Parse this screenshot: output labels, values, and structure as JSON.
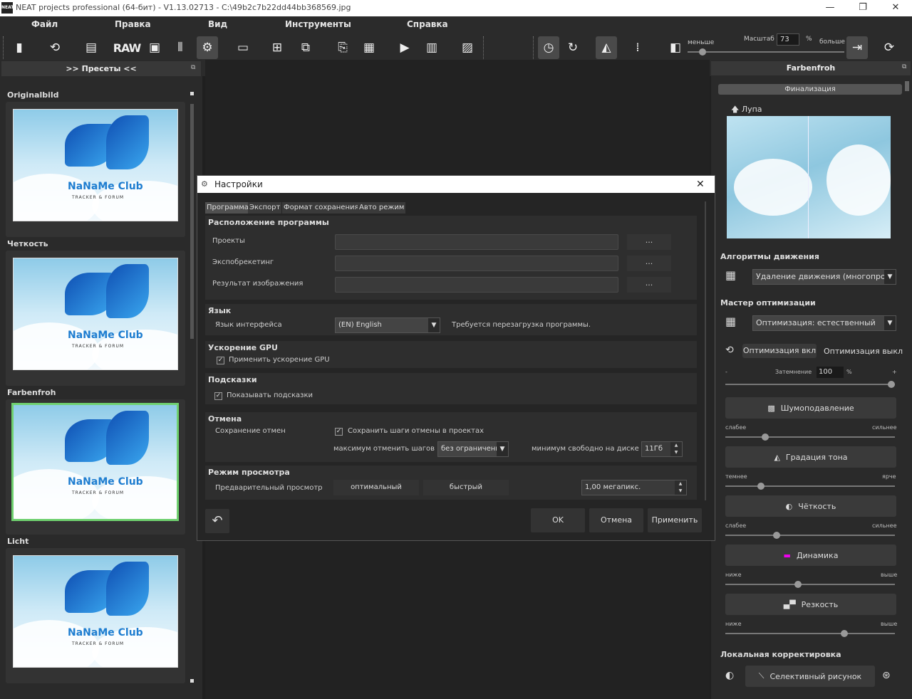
{
  "window": {
    "title": "NEAT projects professional (64-бит) - V1.13.02713 - C:\\49b2c7b22dd44bb368569.jpg",
    "logo_text": "NEAT",
    "minimize": "—",
    "restore": "❐",
    "close": "✕"
  },
  "menu": {
    "file": "Файл",
    "edit": "Правка",
    "view": "Вид",
    "tools": "Инструменты",
    "help": "Справка"
  },
  "toolbar": {
    "raw_label": "RAW",
    "zoom_less": "меньше",
    "zoom_more": "больше",
    "zoom_label": "Масштаб",
    "zoom_value": "73",
    "zoom_unit": "%"
  },
  "left_panel": {
    "title": ">> Пресеты <<",
    "presets": [
      {
        "label": "Originalbild",
        "selected": false
      },
      {
        "label": "Четкость",
        "selected": false
      },
      {
        "label": "Farbenfroh",
        "selected": true
      },
      {
        "label": "Licht",
        "selected": false
      }
    ],
    "thumb_brand": "NaNaMe Club",
    "thumb_sub": "TRACKER & FORUM"
  },
  "right_panel": {
    "title": "Farbenfroh",
    "finalize_button": "Финализация",
    "loupe_label": "Лупа",
    "motion_section": "Алгоритмы движения",
    "motion_value": "Удаление движения (многопроходн",
    "optim_section": "Мастер оптимизации",
    "optim_value": "Оптимизация: естественный",
    "optim_on": "Оптимизация вкл",
    "optim_off": "Оптимизация выкл",
    "darken_minus": "-",
    "darken_plus": "+",
    "darken_label": "Затемнение",
    "darken_value": "100",
    "darken_unit": "%",
    "noise_button": "Шумоподавление",
    "noise_left": "слабее",
    "noise_right": "сильнее",
    "tone_button": "Градация тона",
    "tone_left": "темнее",
    "tone_right": "ярче",
    "sharp_button": "Чёткость",
    "sharp_left": "слабее",
    "sharp_right": "сильнее",
    "dyn_button": "Динамика",
    "dyn_left": "ниже",
    "dyn_right": "выше",
    "crisp_button": "Резкость",
    "crisp_left": "ниже",
    "crisp_right": "выше",
    "local_section": "Локальная корректировка",
    "selective_button": "Селективный рисунок"
  },
  "dialog": {
    "title": "Настройки",
    "close": "✕",
    "tabs": [
      "Программа",
      "Экспорт",
      "Формат сохранения",
      "Авто режим"
    ],
    "location": {
      "title": "Расположение программы",
      "projects": "Проекты",
      "exposure": "Экспобрекетинг",
      "result": "Результат изображения",
      "browse": "..."
    },
    "language": {
      "title": "Язык",
      "label": "Язык интерфейса",
      "value": "(EN) English",
      "note": "Требуется перезагрузка программы."
    },
    "gpu": {
      "title": "Ускорение GPU",
      "checkbox": "Применить ускорение GPU"
    },
    "hints": {
      "title": "Подсказки",
      "checkbox": "Показывать подсказки"
    },
    "undo": {
      "title": "Отмена",
      "label": "Сохранение отмен",
      "checkbox": "Сохранить шаги отмены в проектах",
      "max_label": "максимум отменить шагов",
      "max_value": "без ограничени",
      "min_label": "минимум свободно на диске",
      "min_value": "11Гб"
    },
    "preview": {
      "title": "Режим просмотра",
      "label": "Предварительный просмотр",
      "optimal": "оптимальный",
      "fast": "быстрый",
      "mp_value": "1,00 мегапикс."
    },
    "buttons": {
      "ok": "OK",
      "cancel": "Отмена",
      "apply": "Применить"
    }
  }
}
